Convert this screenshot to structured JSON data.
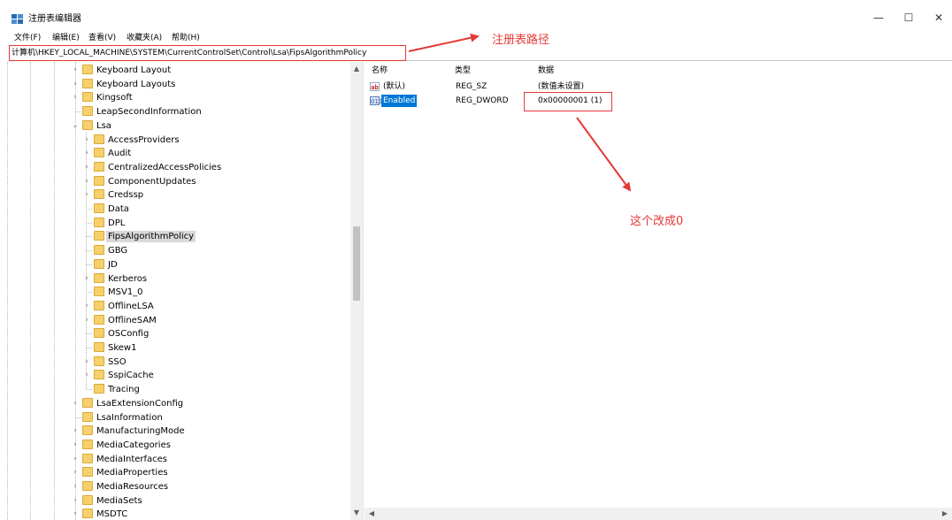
{
  "window": {
    "title": "注册表编辑器",
    "minimize_glyph": "—",
    "maximize_glyph": "☐",
    "close_glyph": "✕"
  },
  "menu": [
    "文件(F)",
    "编辑(E)",
    "查看(V)",
    "收藏夹(A)",
    "帮助(H)"
  ],
  "address": {
    "path": "计算机\\HKEY_LOCAL_MACHINE\\SYSTEM\\CurrentControlSet\\Control\\Lsa\\FipsAlgorithmPolicy"
  },
  "tree": {
    "items": [
      {
        "label": "Keyboard Layout",
        "level": 0,
        "expander": "collapsed"
      },
      {
        "label": "Keyboard Layouts",
        "level": 0,
        "expander": "collapsed"
      },
      {
        "label": "Kingsoft",
        "level": 0,
        "expander": "collapsed"
      },
      {
        "label": "LeapSecondInformation",
        "level": 0,
        "expander": "none"
      },
      {
        "label": "Lsa",
        "level": 0,
        "expander": "expanded"
      },
      {
        "label": "AccessProviders",
        "level": 1,
        "expander": "collapsed"
      },
      {
        "label": "Audit",
        "level": 1,
        "expander": "collapsed"
      },
      {
        "label": "CentralizedAccessPolicies",
        "level": 1,
        "expander": "collapsed"
      },
      {
        "label": "ComponentUpdates",
        "level": 1,
        "expander": "collapsed"
      },
      {
        "label": "Credssp",
        "level": 1,
        "expander": "collapsed"
      },
      {
        "label": "Data",
        "level": 1,
        "expander": "none"
      },
      {
        "label": "DPL",
        "level": 1,
        "expander": "none"
      },
      {
        "label": "FipsAlgorithmPolicy",
        "level": 1,
        "expander": "none",
        "selected": true
      },
      {
        "label": "GBG",
        "level": 1,
        "expander": "none"
      },
      {
        "label": "JD",
        "level": 1,
        "expander": "none"
      },
      {
        "label": "Kerberos",
        "level": 1,
        "expander": "collapsed"
      },
      {
        "label": "MSV1_0",
        "level": 1,
        "expander": "none"
      },
      {
        "label": "OfflineLSA",
        "level": 1,
        "expander": "collapsed"
      },
      {
        "label": "OfflineSAM",
        "level": 1,
        "expander": "collapsed"
      },
      {
        "label": "OSConfig",
        "level": 1,
        "expander": "none"
      },
      {
        "label": "Skew1",
        "level": 1,
        "expander": "none"
      },
      {
        "label": "SSO",
        "level": 1,
        "expander": "collapsed"
      },
      {
        "label": "SspiCache",
        "level": 1,
        "expander": "collapsed"
      },
      {
        "label": "Tracing",
        "level": 1,
        "expander": "none"
      },
      {
        "label": "LsaExtensionConfig",
        "level": 0,
        "expander": "collapsed"
      },
      {
        "label": "LsaInformation",
        "level": 0,
        "expander": "none"
      },
      {
        "label": "ManufacturingMode",
        "level": 0,
        "expander": "collapsed"
      },
      {
        "label": "MediaCategories",
        "level": 0,
        "expander": "collapsed"
      },
      {
        "label": "MediaInterfaces",
        "level": 0,
        "expander": "collapsed"
      },
      {
        "label": "MediaProperties",
        "level": 0,
        "expander": "collapsed"
      },
      {
        "label": "MediaResources",
        "level": 0,
        "expander": "collapsed"
      },
      {
        "label": "MediaSets",
        "level": 0,
        "expander": "collapsed"
      },
      {
        "label": "MSDTC",
        "level": 0,
        "expander": "collapsed"
      }
    ]
  },
  "values": {
    "columns": {
      "name": "名称",
      "type": "类型",
      "data": "数据"
    },
    "rows": [
      {
        "icon": "string-value-icon",
        "icon_text": "ab",
        "name": "(默认)",
        "type": "REG_SZ",
        "data": "(数值未设置)",
        "selected": false
      },
      {
        "icon": "binary-value-icon",
        "icon_text": "011",
        "name": "Enabled",
        "type": "REG_DWORD",
        "data": "0x00000001 (1)",
        "selected": true
      }
    ]
  },
  "annotations": {
    "path_label": "注册表路径",
    "change_label": "这个改成0",
    "color": "#e53935"
  },
  "colors": {
    "selection": "#0078d7",
    "folder": "#f6d06a",
    "tree_selection": "#d9d9d9"
  }
}
